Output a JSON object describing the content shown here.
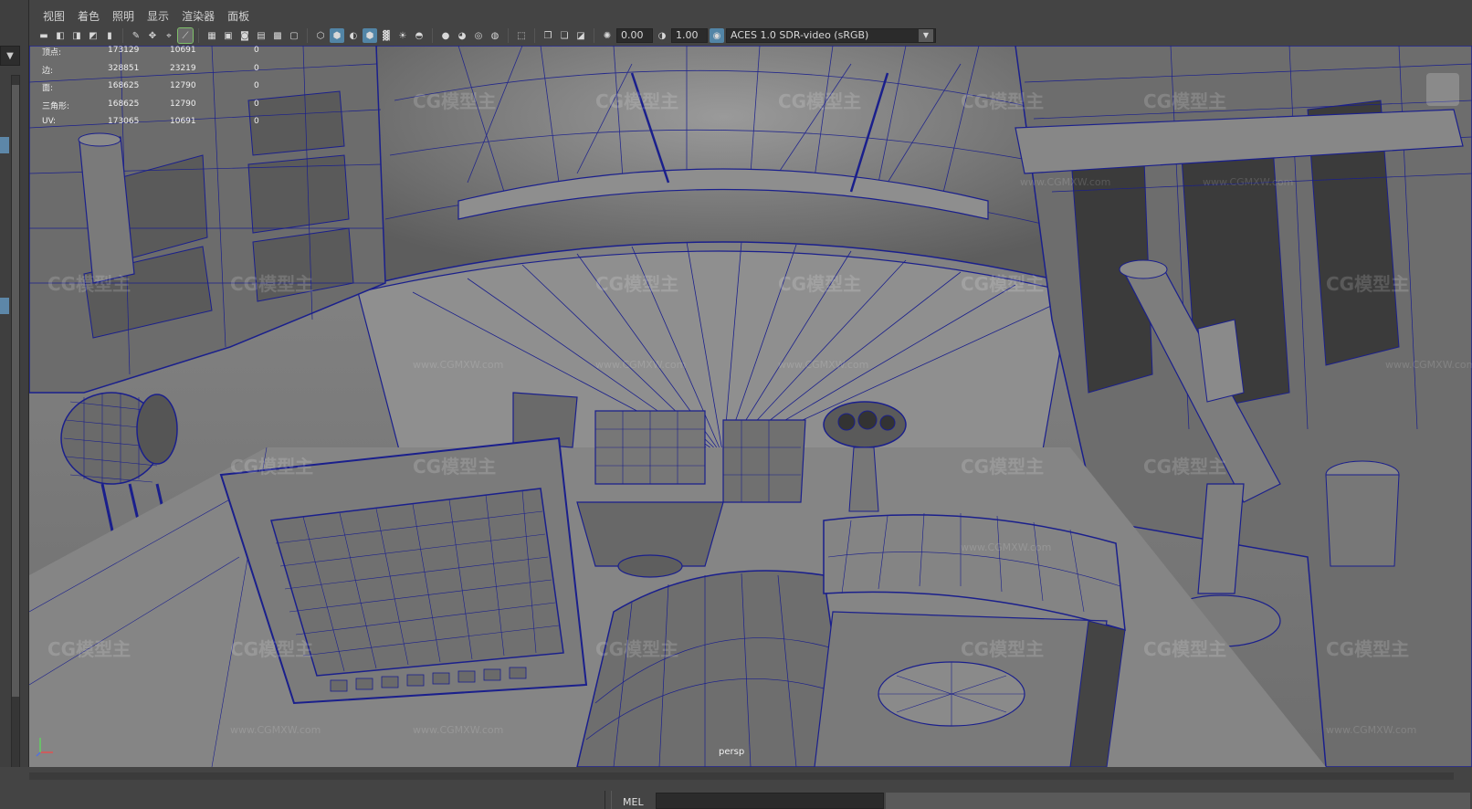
{
  "menu": {
    "items": [
      "视图",
      "着色",
      "照明",
      "显示",
      "渲染器",
      "面板"
    ]
  },
  "toolbar": {
    "exposure_value": "0.00",
    "gamma_value": "1.00",
    "colorspace": "ACES 1.0 SDR-video (sRGB)"
  },
  "hud": {
    "rows": [
      {
        "label": "顶点:",
        "total": "173129",
        "selected": "10691",
        "extra": "0"
      },
      {
        "label": "边:",
        "total": "328851",
        "selected": "23219",
        "extra": "0"
      },
      {
        "label": "面:",
        "total": "168625",
        "selected": "12790",
        "extra": "0"
      },
      {
        "label": "三角形:",
        "total": "168625",
        "selected": "12790",
        "extra": "0"
      },
      {
        "label": "UV:",
        "total": "173065",
        "selected": "10691",
        "extra": "0"
      }
    ]
  },
  "viewport": {
    "camera": "persp",
    "watermark_logo": "CG模型主",
    "watermark_url": "www.CGMXW.com"
  },
  "command_line": {
    "label": "MEL"
  },
  "colors": {
    "wire": "#1a1f8c",
    "surface": "#7c7c7c",
    "highlight": "#5285a6"
  }
}
